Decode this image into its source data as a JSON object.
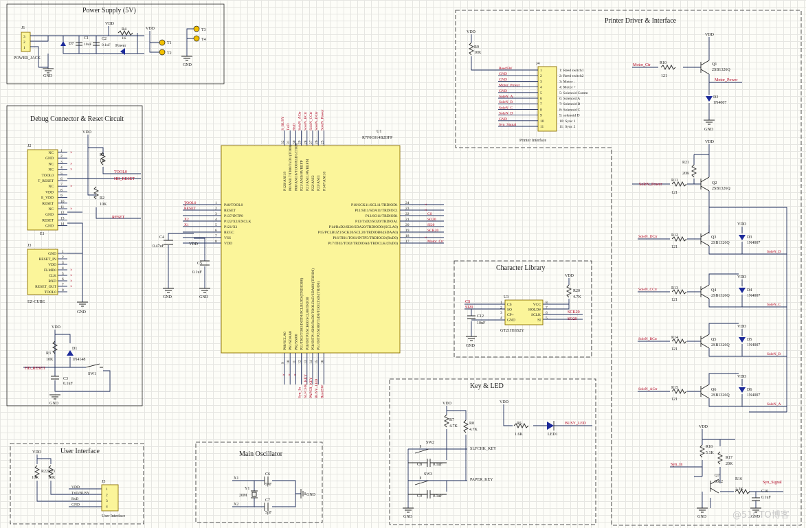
{
  "sections": {
    "power": "Power Supply (5V)",
    "debug": "Debug Connector & Reset Circuit",
    "printer": "Printer Driver & Interface",
    "charlib": "Character Library",
    "key": "Key & LED",
    "user": "User Interface",
    "osc": "Main Oscillator"
  },
  "power": {
    "vdd": "VDD",
    "gnd": "GND",
    "j1": "J1",
    "jack": "POWER_JACK",
    "jpins": [
      "3",
      "2",
      "1"
    ],
    "d7": "D7",
    "c1": "C1",
    "c1v": "10uF",
    "c2": "C2",
    "c2v": "0.1uF",
    "r4": "R4",
    "r4v": "1K",
    "led": "Power",
    "t1": "T1",
    "t2": "T2",
    "t3": "T3",
    "t4": "T4"
  },
  "debug": {
    "vdd": "VDD",
    "gnd": "GND",
    "j2": "J2",
    "e1": "E1",
    "j3": "J3",
    "ez": "EZ-CUBE",
    "j2pins": [
      "NC",
      "GND",
      "NC",
      "NC",
      "TOOL0",
      "T_RESET",
      "NC",
      "VDD",
      "E_VDD",
      "RESET",
      "NC",
      "GND",
      "RESET",
      "GND"
    ],
    "j3pins": [
      "GND",
      "RESET_IN",
      "VDD",
      "FLMD0",
      "CLK",
      "RXD",
      "RESET_OUT",
      "TOOL0"
    ],
    "r1": "R1",
    "r1v": "1K",
    "r2": "R2",
    "r2v": "10K",
    "tool0": "TOOL0",
    "hdreset": "HD_RESET",
    "reset": "RESET",
    "r3": "R3",
    "r3v": "10K",
    "d1": "D1",
    "d1v": "1N4148",
    "c3": "C3",
    "c3v": "0.1uF",
    "sw1": "SW1",
    "hd_reset2": "HD_RESET"
  },
  "mcu": {
    "u1": "U1",
    "part": "R7F0C014B2DFP",
    "left": [
      "P40/TOOL0",
      "RESET",
      "P137/INTP0",
      "P122/X2/EXCLK",
      "P121/X1",
      "REGC",
      "VSS",
      "VDD"
    ],
    "leftnums": [
      "1",
      "2",
      "3",
      "4",
      "5",
      "6",
      "7",
      "8"
    ],
    "leftnets": [
      "TOOL0",
      "RESET",
      "",
      "X2",
      "X1",
      "",
      "",
      ""
    ],
    "right": [
      "P10/SCK11/SCL11/TRDIOD1",
      "P11/SI11/SDA11/TRDIOC1",
      "P12/SO11/TRDIOB1",
      "P13/TxD2/SO20/TRDIOA1",
      "P14/RxD2/SI20/SDA20/TRDIOD0/(SCLA0)",
      "P15/PCLBUZ1/SCK20/SCL20/TRDIOB0/(SDAA0)",
      "P16/TI01/TO01/INTP5/TRDIOC0/(RxD0)",
      "P17/TI02/TO02/TRDIOA0/TRDCLK/(TxD0)"
    ],
    "rightnums": [
      "24",
      "23",
      "22",
      "21",
      "20",
      "19",
      "18",
      "17"
    ],
    "rightnets": [
      "",
      "",
      "CS",
      "SO20",
      "SI20",
      "SCK20",
      "",
      "Motor_Ctr"
    ],
    "top": [
      "P120/ANI19",
      "P0/ANI17/TI00/TxD1/(TO00)",
      "P00/ANI16/TO00/RxD1/(TI00)",
      "P21/ANI0/AVREFP",
      "P21/ANI1/AVREFM",
      "P22/ANI2",
      "P23/ANI3",
      "P147/ANI18"
    ],
    "topnums": [
      "32",
      "31",
      "30",
      "29",
      "28",
      "27",
      "26",
      "25"
    ],
    "topnets": [
      "S_BUSY",
      "TxD",
      "RxD",
      "SoleN_ACtr",
      "SoleN_BCtr",
      "SoleN_CCtr",
      "SoleN_DCtr",
      "SoleN_Power"
    ],
    "bottom": [
      "P60/SCLA0",
      "P61/SDAA0",
      "P62/SSI00",
      "P31/TI03/TO03/INTP4/PCLBUZ0/(TRDIOB0)",
      "P30/INTP3/SCK00/SCL00/TRJO0",
      "P50/INTP1/SI00/RxD0/TOOLRxD/SDA00/(TRJIO0)",
      "P51/INTP2/SO00/TxD0/TOOLTxD/(TRJO0)"
    ],
    "bottomnums": [
      "9",
      "10",
      "11",
      "12",
      "13",
      "14",
      "15",
      "16"
    ],
    "bottomnets": [
      "",
      "",
      "",
      "Syn_In",
      "SLFCHK_KEY",
      "PAPER_KEY",
      "BUSY_LED",
      "ReedSW"
    ],
    "c4": "C4",
    "c4v": "0.47uF",
    "c5": "C5",
    "c5v": "0.1uF",
    "vdd": "VDD",
    "gnd": "GND"
  },
  "printer": {
    "vdd": "VDD",
    "gnd": "GND",
    "r9": "R9",
    "r9v": "10K",
    "j4": "J4",
    "iface": "Printer Interface",
    "nets": [
      "ReedSW",
      "GND",
      "GND",
      "Motor_Power",
      "GND",
      "SoleN_A",
      "SoleN_B",
      "SoleN_C",
      "SoleN_D",
      "GND",
      "Syn_Signal"
    ],
    "desc": [
      "1: Reed switch1",
      "2: Reed switch2",
      "3: Motor -",
      "4: Motor +",
      "5: Solenoid Comm",
      "6: Solenoid A",
      "7: Solenoid B",
      "8: Solenoid C",
      "9: solenoid D",
      "10: Sync 1",
      "11: Sync 2"
    ],
    "nums": [
      "1",
      "2",
      "3",
      "4",
      "5",
      "6",
      "7",
      "8",
      "9",
      "10",
      "11"
    ],
    "motorctr": "Motor_Ctr",
    "r10": "R10",
    "r10v": "121",
    "q1": "Q1",
    "q1v": "2SB1326Q",
    "motorpower": "Motor_Power",
    "d2": "D2",
    "d2v": "1N4007",
    "r21": "R21",
    "r21v": "20K",
    "solenpower": "SoleN_Power",
    "r11": "R11",
    "r11v": "121",
    "q2": "Q2",
    "q2v": "2SB1326Q",
    "solendctr": "SoleN_DCtr",
    "r12": "R12",
    "r12v": "121",
    "q3": "Q3",
    "q3v": "2SB1326Q",
    "d3": "D3",
    "d3v": "1N4007",
    "solend": "SoleN_D",
    "solencctr": "SoleN_CCtr",
    "r13": "R13",
    "r13v": "121",
    "q4": "Q4",
    "q4v": "2SB1326Q",
    "d4": "D4",
    "d4v": "1N4007",
    "solenc": "SoleN_C",
    "solenbctr": "SoleN_BCtr",
    "r14": "R14",
    "r14v": "121",
    "q5": "Q5",
    "q5v": "2SB1326Q",
    "d5": "D5",
    "d5v": "1N4007",
    "solenb": "SoleN_B",
    "solenactr": "SoleN_ACtr",
    "r15": "R15",
    "r15v": "121",
    "q6": "Q6",
    "q6v": "2SB1326Q",
    "d6": "D6",
    "d6v": "1N4007",
    "solena": "SoleN_A",
    "r18": "R18",
    "r18v": "5.1K",
    "r17": "R17",
    "r17v": "20K",
    "synin": "Syn_In",
    "q7": "Q7",
    "q7v": "9012",
    "r16": "R16",
    "r16v": "2.2K",
    "synsignal": "Syn_Signal",
    "c10": "C10",
    "c10v": "0.1uF"
  },
  "charlib": {
    "u3": "U3",
    "part": "GT21H16S2Y",
    "vdd": "VDD",
    "gnd": "GND",
    "lpins": [
      "CS",
      "SO",
      "CP+",
      "GND"
    ],
    "lnums": [
      "1",
      "2",
      "3",
      "4"
    ],
    "rpins": [
      "VCC",
      "HOLD#",
      "SCLK",
      "SI"
    ],
    "rnums": [
      "8",
      "7",
      "6",
      "5"
    ],
    "cs": "CS",
    "si20": "SI20",
    "sck20": "SCK20",
    "so20": "SO20",
    "c12": "C12",
    "c12v": "10uF",
    "r20": "R20",
    "r20v": "4.7K"
  },
  "key": {
    "vdd": "VDD",
    "gnd": "GND",
    "r7": "R7",
    "r7v": "4.7K",
    "r8": "R8",
    "r8v": "4.7K",
    "sw2": "SW2",
    "sw3": "SW3",
    "c8": "C8",
    "c8v": "0.1uF",
    "c9": "C9",
    "c9v": "0.1uF",
    "slfchk": "SLFCHK_KEY",
    "paper": "PAPER_KEY",
    "r5": "R5",
    "r5v": "1.6K",
    "led1": "LED1",
    "busyled": "BUSY_LED"
  },
  "user": {
    "vdd": "VDD",
    "r22": "R22",
    "r22v": "10K",
    "r23": "R23",
    "r23v": "10K",
    "nets": [
      "VDD",
      "TxD/BUSY",
      "RxD",
      "GND"
    ],
    "nums": [
      "1",
      "2",
      "3",
      "4"
    ],
    "j5": "J5",
    "iface": "User Interface"
  },
  "osc": {
    "x1": "X1",
    "x2": "X2",
    "y": "Y1",
    "yv": "20M",
    "c6": "C6",
    "c6v": "5pF",
    "c7": "C7",
    "c7v": "5pF",
    "gnd": "GND"
  },
  "watermark": "@51CTO博客"
}
